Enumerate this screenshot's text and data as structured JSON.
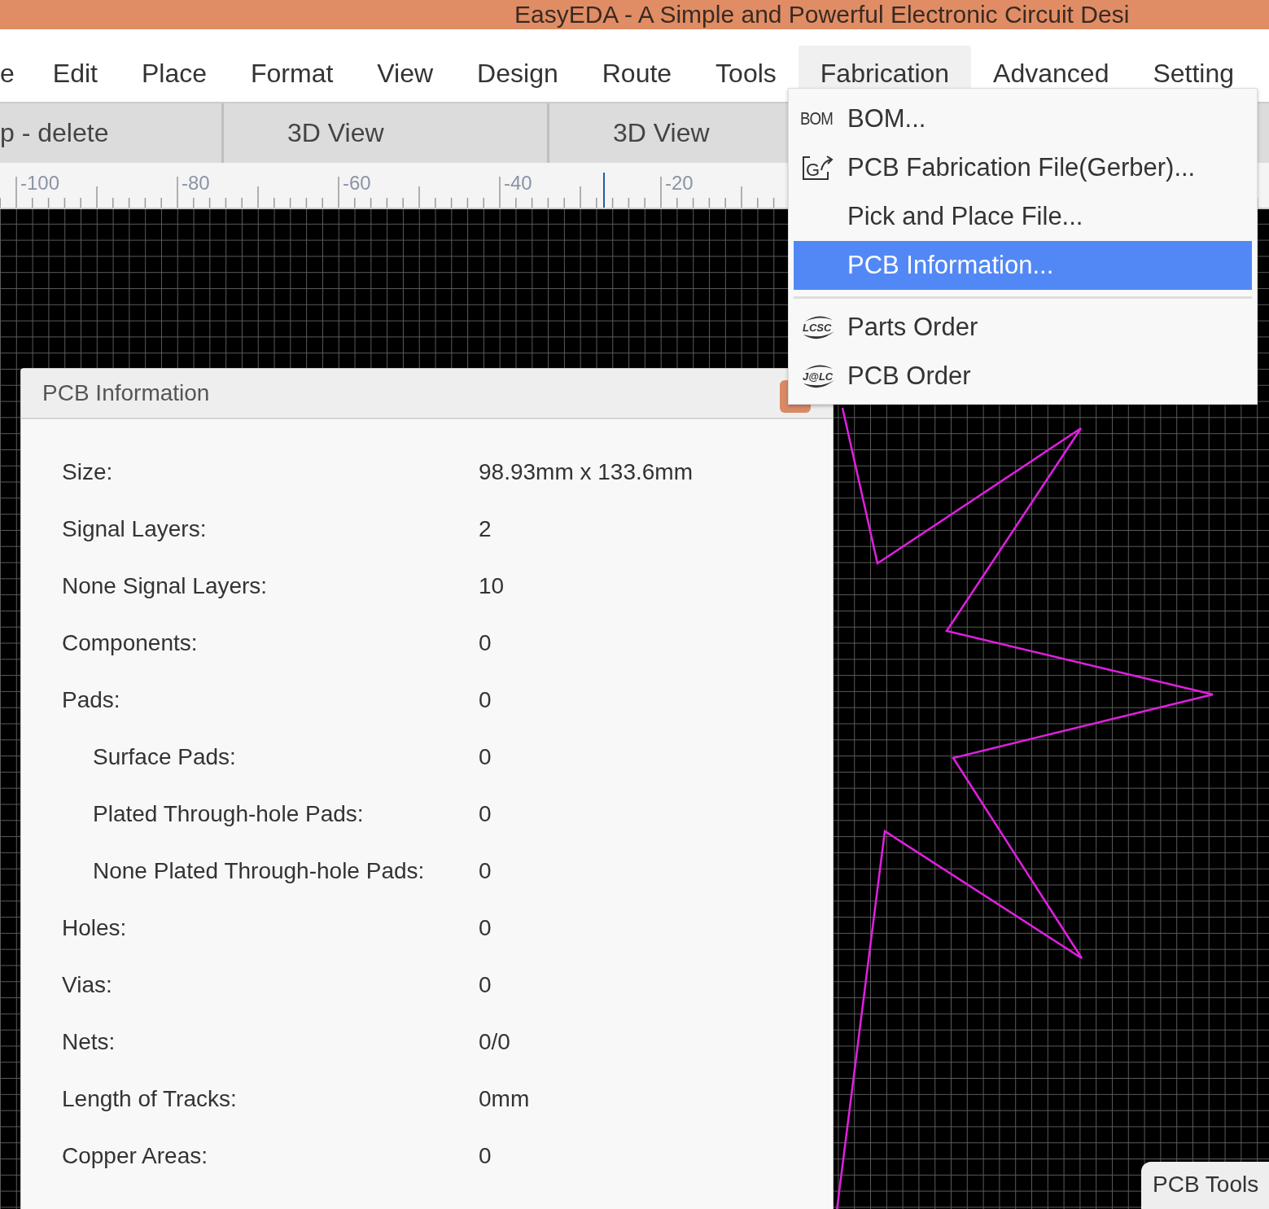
{
  "window": {
    "title": "EasyEDA - A Simple and Powerful Electronic Circuit Desi"
  },
  "menu_bar": [
    {
      "label": "e",
      "selected": false
    },
    {
      "label": "Edit",
      "selected": false
    },
    {
      "label": "Place",
      "selected": false
    },
    {
      "label": "Format",
      "selected": false
    },
    {
      "label": "View",
      "selected": false
    },
    {
      "label": "Design",
      "selected": false
    },
    {
      "label": "Route",
      "selected": false
    },
    {
      "label": "Tools",
      "selected": false
    },
    {
      "label": "Fabrication",
      "selected": true
    },
    {
      "label": "Advanced",
      "selected": false
    },
    {
      "label": "Setting",
      "selected": false
    }
  ],
  "tabs": [
    {
      "label": "p - delete"
    },
    {
      "label": "3D View"
    },
    {
      "label": "3D View"
    }
  ],
  "ruler": {
    "labels": [
      "-100",
      "-80",
      "-60",
      "-40",
      "-20"
    ]
  },
  "dialog": {
    "title": "PCB Information",
    "rows": [
      {
        "label": "Size:",
        "value": "98.93mm x 133.6mm"
      },
      {
        "label": "Signal Layers:",
        "value": "2"
      },
      {
        "label": "None Signal Layers:",
        "value": "10"
      },
      {
        "label": "Components:",
        "value": "0"
      },
      {
        "label": "Pads:",
        "value": "0",
        "children": [
          {
            "label": "Surface Pads:",
            "value": "0"
          },
          {
            "label": "Plated Through-hole Pads:",
            "value": "0"
          },
          {
            "label": "None Plated Through-hole Pads:",
            "value": "0"
          }
        ]
      },
      {
        "label": "Holes:",
        "value": "0"
      },
      {
        "label": "Vias:",
        "value": "0"
      },
      {
        "label": "Nets:",
        "value": "0/0"
      },
      {
        "label": "Length of Tracks:",
        "value": "0mm"
      },
      {
        "label": "Copper Areas:",
        "value": "0"
      }
    ]
  },
  "dropdown": {
    "groups": [
      [
        {
          "label": "BOM...",
          "selected": false,
          "icon": {
            "kind": "text",
            "text": "BOM"
          }
        },
        {
          "label": "PCB Fabrication File(Gerber)...",
          "selected": false,
          "icon": {
            "kind": "export",
            "text": "G"
          }
        },
        {
          "label": "Pick and Place File...",
          "selected": false
        },
        {
          "label": "PCB Information...",
          "selected": true
        }
      ],
      [
        {
          "label": "Parts Order",
          "selected": false,
          "icon": {
            "kind": "logo",
            "text": "LCSC"
          }
        },
        {
          "label": "PCB Order",
          "selected": false,
          "icon": {
            "kind": "logo",
            "text": "J@LC"
          }
        }
      ]
    ]
  },
  "side_panel": {
    "title": "PCB Tools"
  }
}
